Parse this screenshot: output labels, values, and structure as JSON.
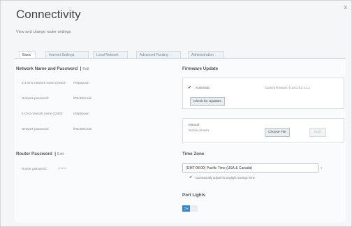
{
  "window": {
    "close_label": "x"
  },
  "header": {
    "title": "Connectivity",
    "subtitle": "View and change router settings"
  },
  "tabs": [
    {
      "label": "Basic"
    },
    {
      "label": "Internet Settings"
    },
    {
      "label": "Local Network"
    },
    {
      "label": "Advanced Routing"
    },
    {
      "label": "Administration"
    }
  ],
  "network": {
    "title": "Network Name and Password",
    "edit": "Edit",
    "rows": [
      {
        "label": "2.4 GHz network name (SSID):",
        "value": "HelpSpoon"
      },
      {
        "label": "Network password:",
        "value": "fPBcE9Code"
      },
      {
        "label": "5 GHz network name (SSID):",
        "value": "HelpSpoon"
      },
      {
        "label": "Network password:",
        "value": "fPBcE9Code"
      }
    ]
  },
  "router_password": {
    "title": "Router Password",
    "edit": "Edit",
    "label": "Router password:",
    "value": "*******"
  },
  "firmware": {
    "title": "Firmware Update",
    "automatic_label": "Automatic",
    "last_checked": "Current firmware: 5.1.8.1.5.2.1.1.1",
    "check_button": "Check for Updates",
    "manual_label": "Manual:",
    "no_file": "No file chosen",
    "choose_file_button": "Choose File",
    "start_button": "Start"
  },
  "timezone": {
    "title": "Time Zone",
    "selected": "(GMT-08:00) Pacific Time (USA & Canada)",
    "dst_label": "Automatically adjust for Daylight Savings Time"
  },
  "port_lights": {
    "title": "Port Lights",
    "on_label": "ON"
  }
}
